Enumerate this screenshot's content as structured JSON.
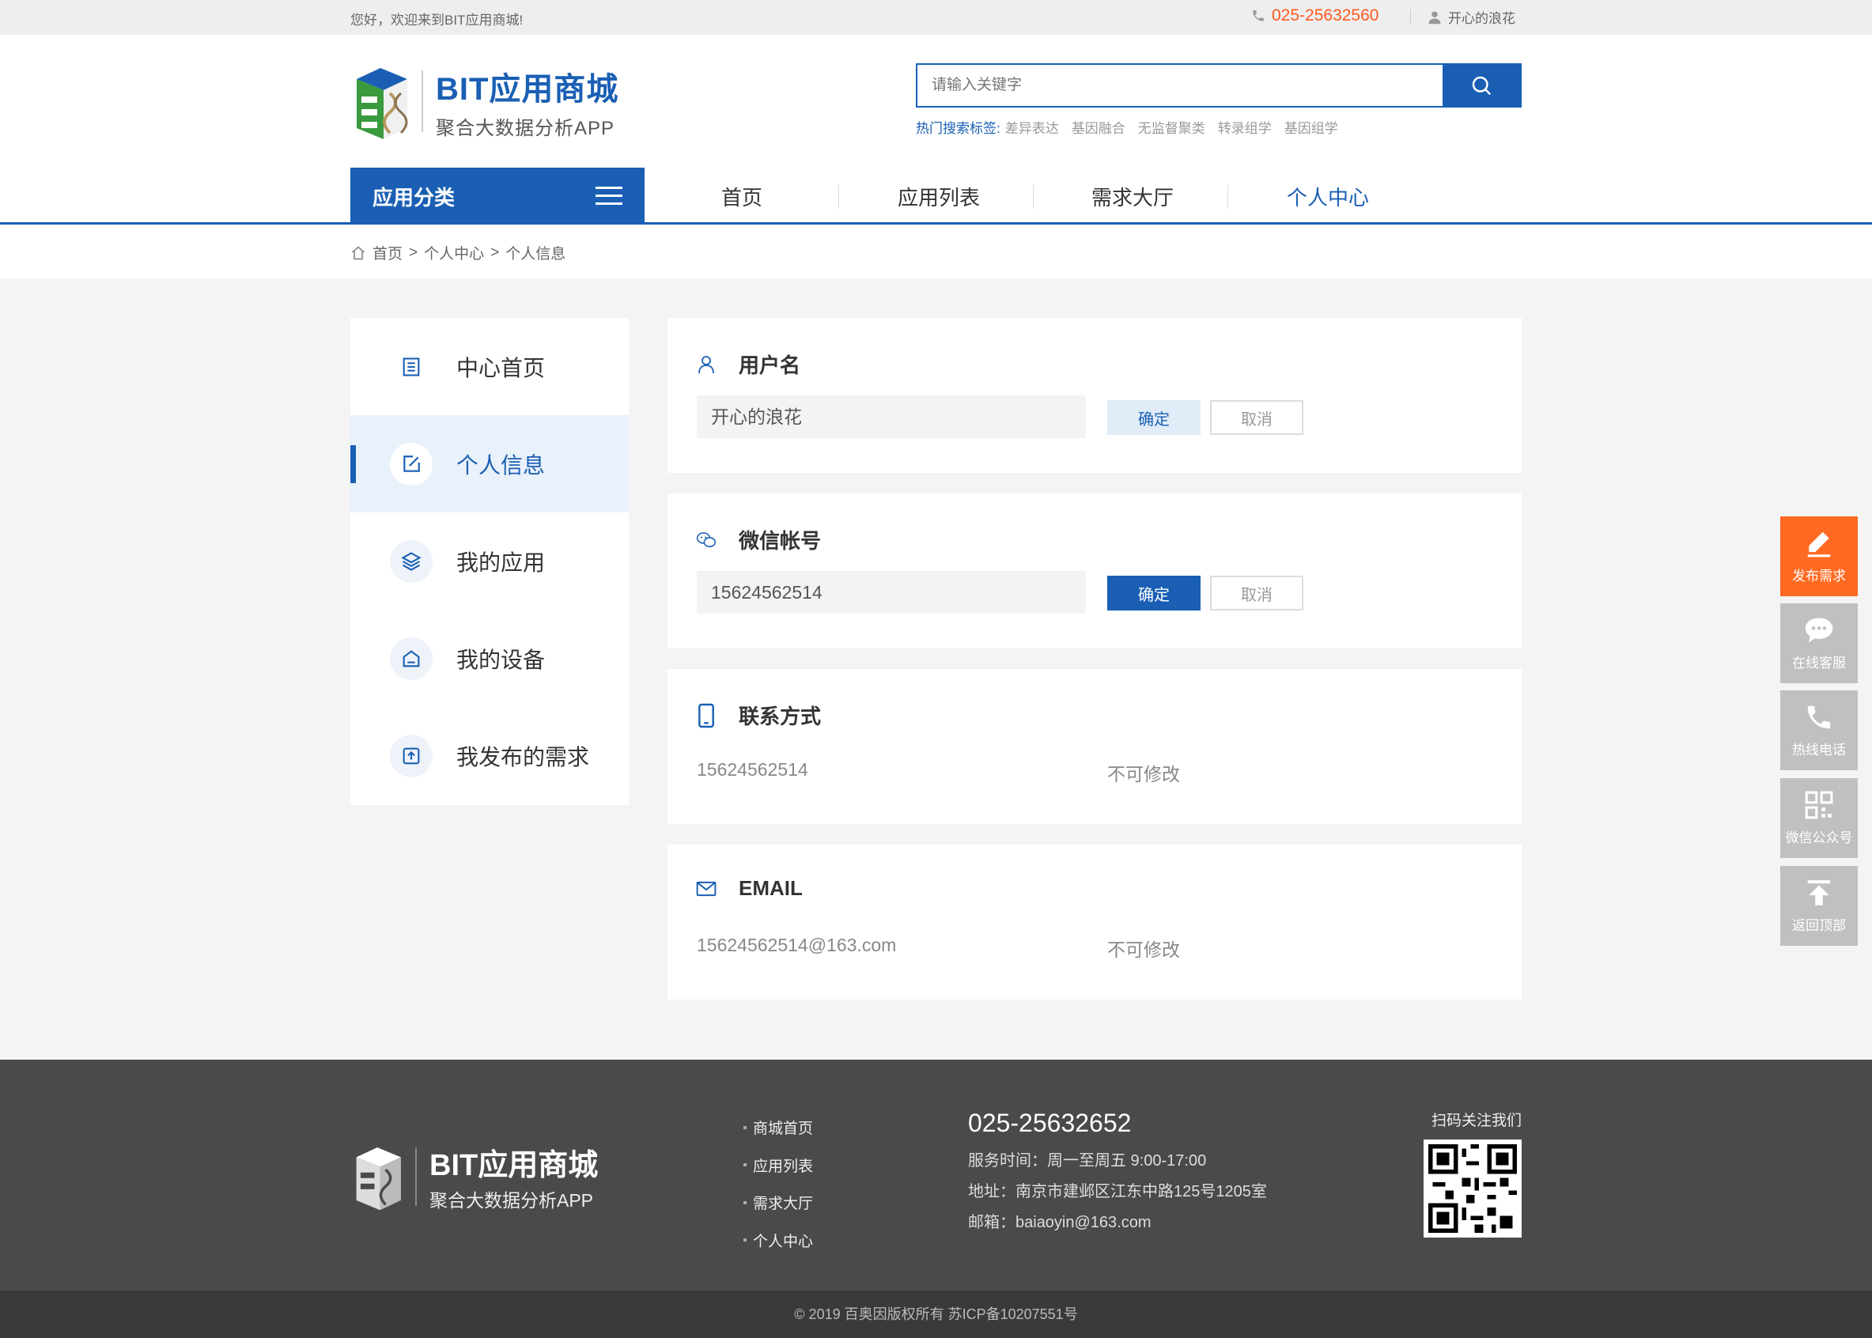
{
  "topbar": {
    "welcome": "您好，欢迎来到BIT应用商城!",
    "phone": "025-25632560",
    "username": "开心的浪花"
  },
  "header": {
    "logo_title": "BIT应用商城",
    "logo_subtitle": "聚合大数据分析APP",
    "search_placeholder": "请输入关键字",
    "hot_label": "热门搜索标签:",
    "hot_tags": [
      "差异表达",
      "基因融合",
      "无监督聚类",
      "转录组学",
      "基因组学"
    ]
  },
  "nav": {
    "category": "应用分类",
    "items": [
      "首页",
      "应用列表",
      "需求大厅",
      "个人中心"
    ],
    "active": "个人中心"
  },
  "breadcrumb": [
    "首页",
    "个人中心",
    "个人信息"
  ],
  "sidebar": {
    "items": [
      {
        "label": "中心首页",
        "icon": "list-icon"
      },
      {
        "label": "个人信息",
        "icon": "edit-icon"
      },
      {
        "label": "我的应用",
        "icon": "layers-icon"
      },
      {
        "label": "我的设备",
        "icon": "home-icon"
      },
      {
        "label": "我发布的需求",
        "icon": "upload-icon"
      }
    ],
    "active_index": 1
  },
  "profile": {
    "username": {
      "title": "用户名",
      "value": "开心的浪花",
      "confirm": "确定",
      "cancel": "取消"
    },
    "wechat": {
      "title": "微信帐号",
      "value": "15624562514",
      "confirm": "确定",
      "cancel": "取消"
    },
    "contact": {
      "title": "联系方式",
      "value": "15624562514",
      "note": "不可修改"
    },
    "email": {
      "title": "EMAIL",
      "value": "15624562514@163.com",
      "note": "不可修改"
    }
  },
  "float_bar": [
    "发布需求",
    "在线客服",
    "热线电话",
    "微信公众号",
    "返回顶部"
  ],
  "footer": {
    "logo_title": "BIT应用商城",
    "logo_subtitle": "聚合大数据分析APP",
    "links": [
      "商城首页",
      "应用列表",
      "需求大厅",
      "个人中心"
    ],
    "tel": "025-25632652",
    "hours": "服务时间：周一至周五 9:00-17:00",
    "address": "地址：南京市建邺区江东中路125号1205室",
    "mail": "邮箱：baiaoyin@163.com",
    "qr_label": "扫码关注我们",
    "copyright": "© 2019 百奥因版权所有    苏ICP备10207551号"
  },
  "colors": {
    "brand": "#1a5fb4",
    "accent": "#ff6a22",
    "footer_bg": "#4a4a4a"
  }
}
